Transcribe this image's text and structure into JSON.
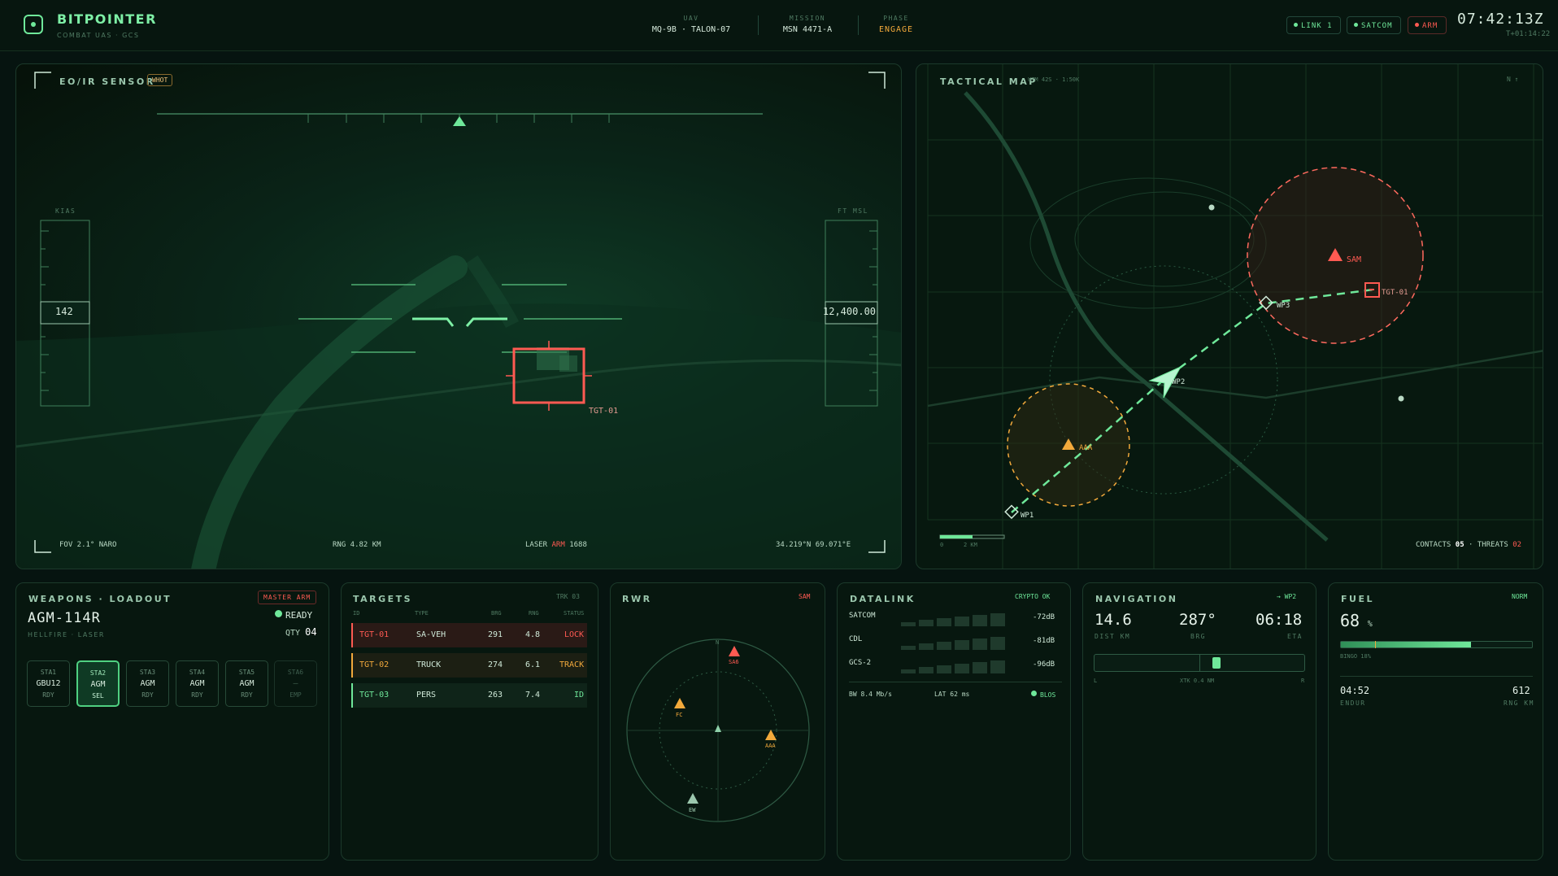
{
  "header": {
    "brand": "BITPOINTER",
    "subtitle": "COMBAT UAS · GCS",
    "uav_label": "UAV",
    "uav_value": "MQ-9B · TALON-07",
    "mission_label": "MISSION",
    "mission_value": "MSN 4471-A",
    "phase_label": "PHASE",
    "phase_value": "ENGAGE",
    "chips": {
      "link": "LINK 1",
      "satcom": "SATCOM",
      "arm": "ARM"
    },
    "clock": "07:42:13Z",
    "clock_sub": "T+01:14:22"
  },
  "sensor": {
    "title": "EO/IR SENSOR",
    "mode_badge": "WHOT",
    "kias_label": "KIAS",
    "kias_value": "142",
    "alt_label": "FT MSL",
    "alt_value": "12,400.00",
    "target_label": "TGT-01",
    "fov": "FOV 2.1° NARO",
    "rng": "RNG 4.82 KM",
    "laser_prefix": "LASER",
    "laser_state": "ARM",
    "laser_code": "1688",
    "coords": "34.219°N 69.071°E"
  },
  "map": {
    "title": "TACTICAL MAP",
    "subtitle": "UTM 42S · 1:50K",
    "north": "N ↑",
    "labels": {
      "sam": "SAM",
      "aaa": "AAA",
      "tgt": "TGT-01",
      "wp1": "WP1",
      "wp2": "WP2",
      "wp3": "WP3"
    },
    "scale_0": "0",
    "scale_2": "2 KM",
    "contacts_label": "CONTACTS",
    "contacts_value": "05",
    "threats_label": "THREATS",
    "threats_value": "02",
    "separator": "·"
  },
  "weapons": {
    "title": "WEAPONS · LOADOUT",
    "master_arm": "MASTER ARM",
    "selected": "AGM-114R",
    "selected_sub": "HELLFIRE · LASER",
    "status": "READY",
    "qty_label": "QTY",
    "qty_value": "04",
    "stations": [
      {
        "id": "STA1",
        "store": "GBU12",
        "state": "RDY"
      },
      {
        "id": "STA2",
        "store": "AGM",
        "state": "SEL"
      },
      {
        "id": "STA3",
        "store": "AGM",
        "state": "RDY"
      },
      {
        "id": "STA4",
        "store": "AGM",
        "state": "RDY"
      },
      {
        "id": "STA5",
        "store": "AGM",
        "state": "RDY"
      },
      {
        "id": "STA6",
        "store": "—",
        "state": "EMP"
      }
    ]
  },
  "targets": {
    "title": "TARGETS",
    "trk": "TRK 03",
    "columns": [
      "ID",
      "TYPE",
      "BRG",
      "RNG",
      "STATUS"
    ],
    "rows": [
      {
        "id": "TGT-01",
        "type": "SA-VEH",
        "brg": "291",
        "rng": "4.8",
        "status": "LOCK"
      },
      {
        "id": "TGT-02",
        "type": "TRUCK",
        "brg": "274",
        "rng": "6.1",
        "status": "TRACK"
      },
      {
        "id": "TGT-03",
        "type": "PERS",
        "brg": "263",
        "rng": "7.4",
        "status": "ID"
      }
    ]
  },
  "rwr": {
    "title": "RWR",
    "alert": "SAM",
    "north": "N",
    "contacts": {
      "sa6": "SA6",
      "fc": "FC",
      "aaa": "AAA",
      "ew": "EW"
    }
  },
  "datalink": {
    "title": "DATALINK",
    "crypto": "CRYPTO OK",
    "links": [
      {
        "name": "SATCOM",
        "level": "-72dB",
        "bars": 6
      },
      {
        "name": "CDL",
        "level": "-81dB",
        "bars": 6
      },
      {
        "name": "GCS-2",
        "level": "-96dB",
        "bars": 6
      }
    ],
    "bw": "BW 8.4 Mb/s",
    "lat": "LAT 62 ms",
    "blos": "BLOS"
  },
  "nav": {
    "title": "NAVIGATION",
    "to": "→ WP2",
    "dist": "14.6",
    "dist_label": "DIST KM",
    "brg": "287°",
    "brg_label": "BRG",
    "eta": "06:18",
    "eta_label": "ETA",
    "xtk_l": "L",
    "xtk": "XTK 0.4 NM",
    "xtk_r": "R",
    "xtk_fraction": 0.58
  },
  "fuel": {
    "title": "FUEL",
    "state": "NORM",
    "pct": "68",
    "pct_unit": "%",
    "fraction": 0.68,
    "bingo": "BINGO 18%",
    "endur": "04:52",
    "endur_label": "ENDUR",
    "rng": "612",
    "rng_label": "RNG KM"
  },
  "colors": {
    "accent": "#6fe89a",
    "threat": "#ff5a52",
    "caution": "#f2a93b",
    "bg": "#061410"
  }
}
